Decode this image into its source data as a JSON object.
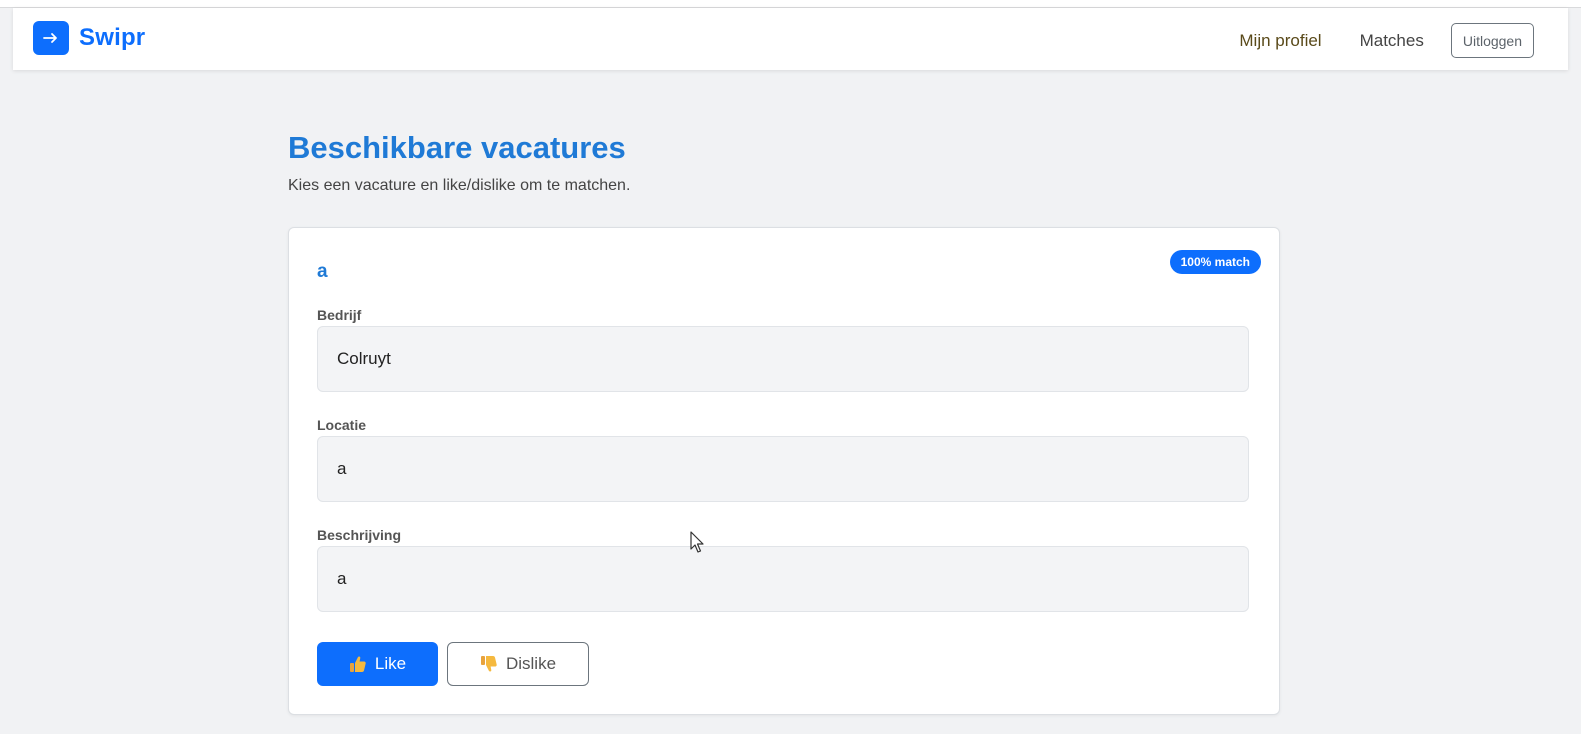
{
  "navbar": {
    "brand": "Swipr",
    "brand_icon": "arrow-right-icon",
    "links": {
      "profile": "Mijn profiel",
      "matches": "Matches"
    },
    "logout": "Uitloggen"
  },
  "page": {
    "title": "Beschikbare vacatures",
    "subtitle": "Kies een vacature en like/dislike om te matchen."
  },
  "vacancy": {
    "title": "a",
    "match_badge": "100% match",
    "fields": {
      "company": {
        "label": "Bedrijf",
        "value": "Colruyt"
      },
      "location": {
        "label": "Locatie",
        "value": "a"
      },
      "description": {
        "label": "Beschrijving",
        "value": "a"
      }
    },
    "actions": {
      "like": "Like",
      "like_icon": "thumbs-up-icon",
      "dislike": "Dislike",
      "dislike_icon": "thumbs-down-icon"
    }
  },
  "colors": {
    "accent": "#0d6efd",
    "heading": "#1f7ad6",
    "background": "#f1f2f4"
  }
}
